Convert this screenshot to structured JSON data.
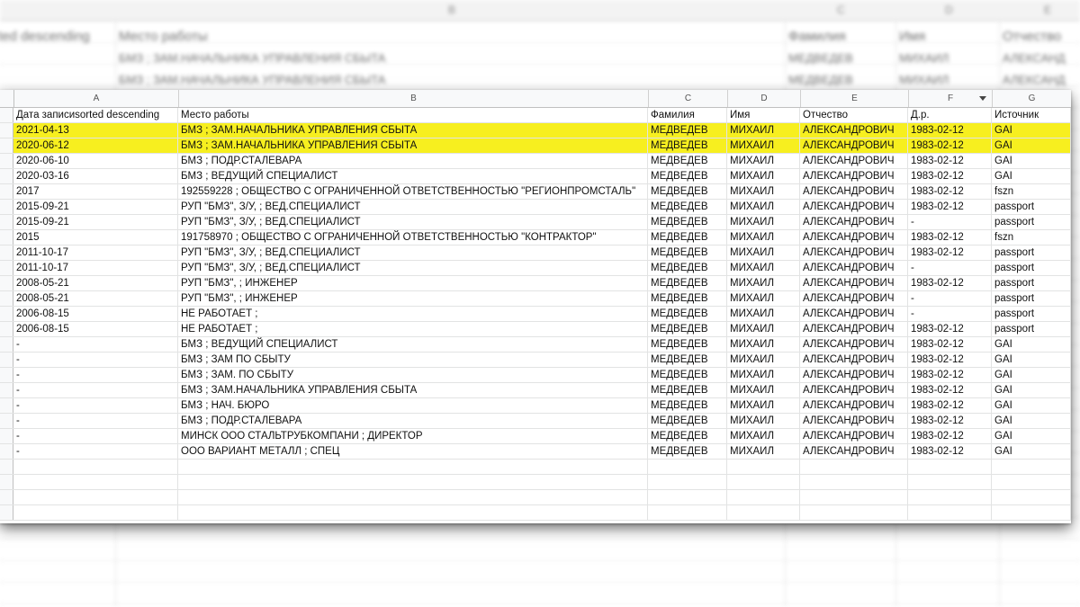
{
  "backdrop": {
    "header_letters": [
      "B",
      "C",
      "D",
      "E"
    ],
    "row1": [
      "ted descending",
      "Место работы",
      "Фамилия",
      "Имя",
      "Отчество"
    ],
    "row2": [
      "БМЗ ; ЗАМ.НАЧАЛЬНИКА УПРАВЛЕНИЯ СБЫТА",
      "МЕДВЕДЕВ",
      "МИХАИЛ",
      "АЛЕКСАНД"
    ],
    "row3": [
      "БМЗ ; ЗАМ.НАЧАЛЬНИКА УПРАВЛЕНИЯ СБЫТА",
      "МЕДВЕДЕВ",
      "МИХАИЛ",
      "АЛЕКСАНД"
    ]
  },
  "sheet": {
    "column_letters": [
      "A",
      "B",
      "C",
      "D",
      "E",
      "F",
      "G"
    ],
    "highlight_color": "#f7ef1f",
    "header": [
      "Дата записиsorted descending",
      "Место работы",
      "Фамилия",
      "Имя",
      "Отчество",
      "Д.р.",
      "Источник"
    ],
    "rows": [
      [
        "2021-04-13",
        "БМЗ ; ЗАМ.НАЧАЛЬНИКА УПРАВЛЕНИЯ СБЫТА",
        "МЕДВЕДЕВ",
        "МИХАИЛ",
        "АЛЕКСАНДРОВИЧ",
        "1983-02-12",
        "GAI"
      ],
      [
        "2020-06-12",
        "БМЗ ; ЗАМ.НАЧАЛЬНИКА УПРАВЛЕНИЯ СБЫТА",
        "МЕДВЕДЕВ",
        "МИХАИЛ",
        "АЛЕКСАНДРОВИЧ",
        "1983-02-12",
        "GAI"
      ],
      [
        "2020-06-10",
        "БМЗ ; ПОДР.СТАЛЕВАРА",
        "МЕДВЕДЕВ",
        "МИХАИЛ",
        "АЛЕКСАНДРОВИЧ",
        "1983-02-12",
        "GAI"
      ],
      [
        "2020-03-16",
        "БМЗ ; ВЕДУЩИЙ СПЕЦИАЛИСТ",
        "МЕДВЕДЕВ",
        "МИХАИЛ",
        "АЛЕКСАНДРОВИЧ",
        "1983-02-12",
        "GAI"
      ],
      [
        "2017",
        "192559228 ; ОБЩЕСТВО С ОГРАНИЧЕННОЙ ОТВЕТСТВЕННОСТЬЮ \"РЕГИОНПРОМСТАЛЬ\"",
        "МЕДВЕДЕВ",
        "МИХАИЛ",
        "АЛЕКСАНДРОВИЧ",
        "1983-02-12",
        "fszn"
      ],
      [
        "2015-09-21",
        "РУП \"БМЗ\", З/У, ; ВЕД.СПЕЦИАЛИСТ",
        "МЕДВЕДЕВ",
        "МИХАИЛ",
        "АЛЕКСАНДРОВИЧ",
        "1983-02-12",
        "passport"
      ],
      [
        "2015-09-21",
        "РУП \"БМЗ\", З/У, ; ВЕД.СПЕЦИАЛИСТ",
        "МЕДВЕДЕВ",
        "МИХАИЛ",
        "АЛЕКСАНДРОВИЧ",
        "-",
        "passport"
      ],
      [
        "2015",
        "191758970 ; ОБЩЕСТВО С ОГРАНИЧЕННОЙ ОТВЕТСТВЕННОСТЬЮ \"КОНТРАКТОР\"",
        "МЕДВЕДЕВ",
        "МИХАИЛ",
        "АЛЕКСАНДРОВИЧ",
        "1983-02-12",
        "fszn"
      ],
      [
        "2011-10-17",
        "РУП \"БМЗ\", З/У, ; ВЕД.СПЕЦИАЛИСТ",
        "МЕДВЕДЕВ",
        "МИХАИЛ",
        "АЛЕКСАНДРОВИЧ",
        "1983-02-12",
        "passport"
      ],
      [
        "2011-10-17",
        "РУП \"БМЗ\", З/У, ; ВЕД.СПЕЦИАЛИСТ",
        "МЕДВЕДЕВ",
        "МИХАИЛ",
        "АЛЕКСАНДРОВИЧ",
        "-",
        "passport"
      ],
      [
        "2008-05-21",
        "РУП \"БМЗ\", ; ИНЖЕНЕР",
        "МЕДВЕДЕВ",
        "МИХАИЛ",
        "АЛЕКСАНДРОВИЧ",
        "1983-02-12",
        "passport"
      ],
      [
        "2008-05-21",
        "РУП \"БМЗ\", ; ИНЖЕНЕР",
        "МЕДВЕДЕВ",
        "МИХАИЛ",
        "АЛЕКСАНДРОВИЧ",
        "-",
        "passport"
      ],
      [
        "2006-08-15",
        "НЕ РАБОТАЕТ ;",
        "МЕДВЕДЕВ",
        "МИХАИЛ",
        "АЛЕКСАНДРОВИЧ",
        "-",
        "passport"
      ],
      [
        "2006-08-15",
        "НЕ РАБОТАЕТ ;",
        "МЕДВЕДЕВ",
        "МИХАИЛ",
        "АЛЕКСАНДРОВИЧ",
        "1983-02-12",
        "passport"
      ],
      [
        "-",
        "БМЗ ; ВЕДУЩИЙ СПЕЦИАЛИСТ",
        "МЕДВЕДЕВ",
        "МИХАИЛ",
        "АЛЕКСАНДРОВИЧ",
        "1983-02-12",
        "GAI"
      ],
      [
        "-",
        "БМЗ ; ЗАМ ПО СБЫТУ",
        "МЕДВЕДЕВ",
        "МИХАИЛ",
        "АЛЕКСАНДРОВИЧ",
        "1983-02-12",
        "GAI"
      ],
      [
        "-",
        "БМЗ ; ЗАМ. ПО СБЫТУ",
        "МЕДВЕДЕВ",
        "МИХАИЛ",
        "АЛЕКСАНДРОВИЧ",
        "1983-02-12",
        "GAI"
      ],
      [
        "-",
        "БМЗ ; ЗАМ.НАЧАЛЬНИКА УПРАВЛЕНИЯ СБЫТА",
        "МЕДВЕДЕВ",
        "МИХАИЛ",
        "АЛЕКСАНДРОВИЧ",
        "1983-02-12",
        "GAI"
      ],
      [
        "-",
        "БМЗ ; НАЧ. БЮРО",
        "МЕДВЕДЕВ",
        "МИХАИЛ",
        "АЛЕКСАНДРОВИЧ",
        "1983-02-12",
        "GAI"
      ],
      [
        "-",
        "БМЗ ; ПОДР.СТАЛЕВАРА",
        "МЕДВЕДЕВ",
        "МИХАИЛ",
        "АЛЕКСАНДРОВИЧ",
        "1983-02-12",
        "GAI"
      ],
      [
        "-",
        "МИНСК ООО СТАЛЬТРУБКОМПАНИ ; ДИРЕКТОР",
        "МЕДВЕДЕВ",
        "МИХАИЛ",
        "АЛЕКСАНДРОВИЧ",
        "1983-02-12",
        "GAI"
      ],
      [
        "-",
        "ООО ВАРИАНТ МЕТАЛЛ ; СПЕЦ",
        "МЕДВЕДЕВ",
        "МИХАИЛ",
        "АЛЕКСАНДРОВИЧ",
        "1983-02-12",
        "GAI"
      ]
    ],
    "highlighted_rows": [
      0,
      1
    ],
    "empty_rows": 4
  }
}
